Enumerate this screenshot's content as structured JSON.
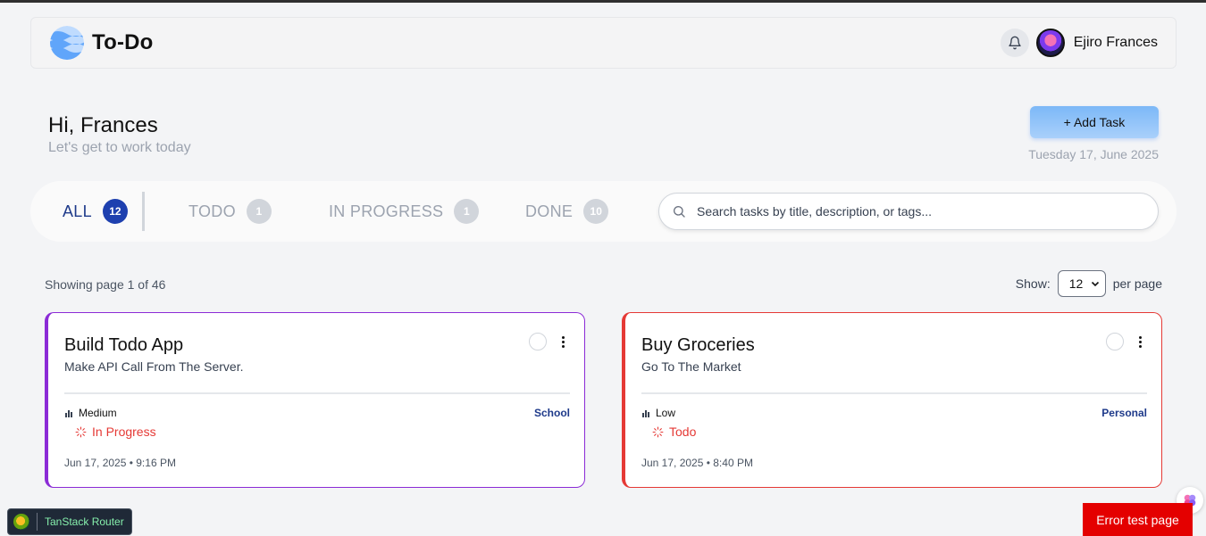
{
  "app": {
    "brand_name": "To-Do",
    "user_name": "Ejiro Frances",
    "accent_color": "#1e40af"
  },
  "greeting": {
    "title": "Hi, Frances",
    "subtitle": "Let's get to work today",
    "add_task_label": "+ Add Task",
    "date": "Tuesday 17, June 2025"
  },
  "tabs": [
    {
      "label": "ALL",
      "count": "12",
      "active": true
    },
    {
      "label": "TODO",
      "count": "1",
      "active": false
    },
    {
      "label": "IN PROGRESS",
      "count": "1",
      "active": false
    },
    {
      "label": "DONE",
      "count": "10",
      "active": false
    }
  ],
  "search": {
    "placeholder": "Search tasks by title, description, or tags...",
    "value": ""
  },
  "paging": {
    "info": "Showing page 1 of 46",
    "show_label": "Show:",
    "per_page_value": "12",
    "per_page_label": "per page"
  },
  "tasks": [
    {
      "title": "Build Todo App",
      "description": "Make API Call From The Server.",
      "priority": "Medium",
      "status": "In Progress",
      "tag": "School",
      "timestamp": "Jun 17, 2025 • 9:16 PM",
      "border_color": "#8b2bd6"
    },
    {
      "title": "Buy Groceries",
      "description": "Go To The Market",
      "priority": "Low",
      "status": "Todo",
      "tag": "Personal",
      "timestamp": "Jun 17, 2025 • 8:40 PM",
      "border_color": "#e53935"
    }
  ],
  "devtools": {
    "tanstack_label": "TanStack Router",
    "error_button_label": "Error test page"
  }
}
